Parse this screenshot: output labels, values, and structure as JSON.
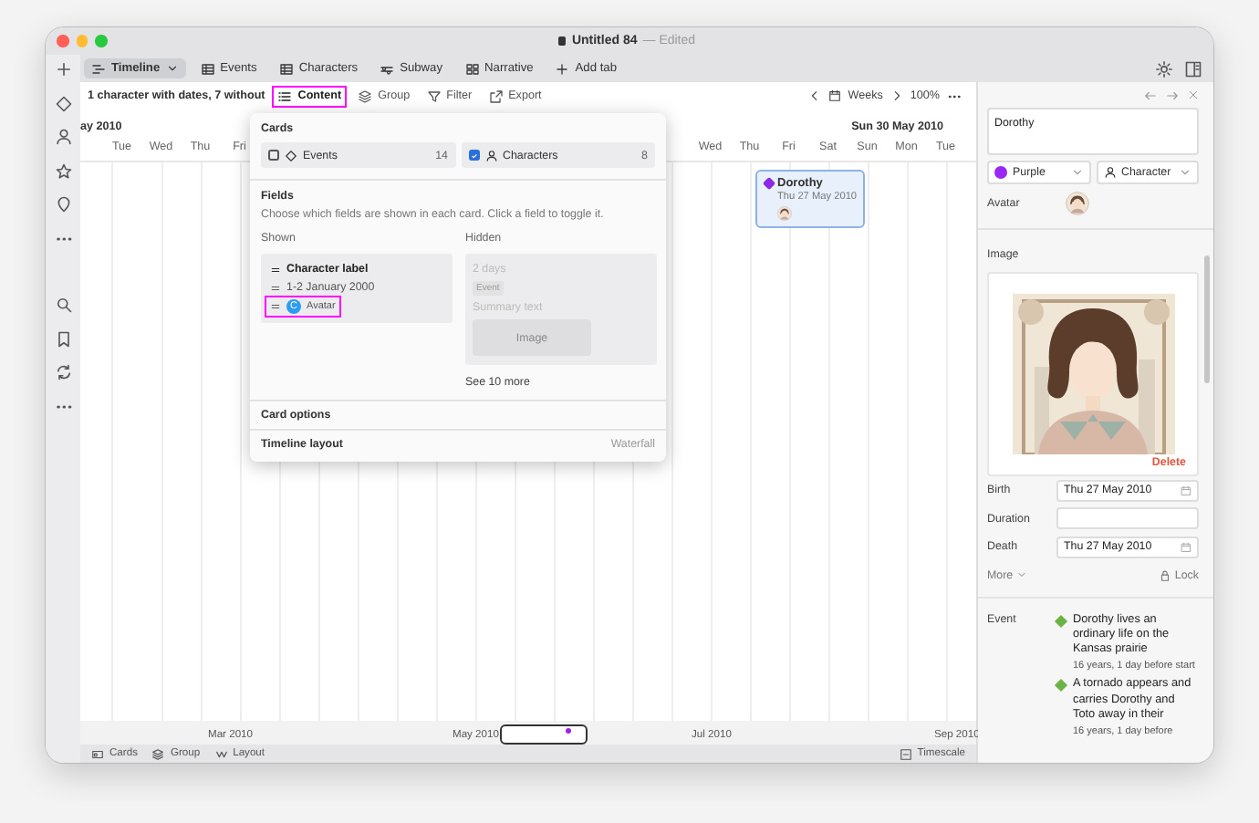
{
  "window": {
    "title": "Untitled 84",
    "status": "— Edited"
  },
  "sidebar": {
    "items": [
      {
        "kind": "add"
      },
      {
        "kind": "diamond"
      },
      {
        "kind": "person"
      },
      {
        "kind": "star"
      },
      {
        "kind": "pin"
      },
      {
        "kind": "dots"
      },
      {
        "kind": "search"
      },
      {
        "kind": "bookmark"
      },
      {
        "kind": "sync"
      },
      {
        "kind": "dots"
      }
    ]
  },
  "tabs": [
    {
      "label": "Timeline",
      "selected": true,
      "kind": "timeline"
    },
    {
      "label": "Events",
      "selected": false,
      "kind": "grid"
    },
    {
      "label": "Characters",
      "selected": false,
      "kind": "grid"
    },
    {
      "label": "Subway",
      "selected": false,
      "kind": "subway"
    },
    {
      "label": "Narrative",
      "selected": false,
      "kind": "narrative"
    },
    {
      "label": "Add tab",
      "selected": false,
      "kind": "plus"
    }
  ],
  "toolbar": {
    "summary": "1 character with dates, 7 without",
    "buttons": [
      {
        "label": "Content",
        "kind": "list",
        "highlighted": true
      },
      {
        "label": "Group",
        "kind": "stack",
        "highlighted": false
      },
      {
        "label": "Filter",
        "kind": "filter",
        "highlighted": false
      },
      {
        "label": "Export",
        "kind": "export",
        "highlighted": false
      }
    ],
    "scale": "Weeks",
    "zoom": "100%"
  },
  "timeline": {
    "month_labels": [
      "ay 2010",
      "Sun 30 May 2010"
    ],
    "days_before": [
      "Tue",
      "Wed",
      "Thu",
      "Fri"
    ],
    "days_after": [
      "Wed",
      "Thu",
      "Fri",
      "Sat",
      "Sun",
      "Mon",
      "Tue"
    ],
    "cards": [
      {
        "name": "Dorothy",
        "date": "Thu 27 May 2010",
        "color": "#8a2be2"
      }
    ]
  },
  "popover": {
    "cards_title": "Cards",
    "card_types": [
      {
        "label": "Events",
        "count": "14",
        "checked": false,
        "kind": "diamond"
      },
      {
        "label": "Characters",
        "count": "8",
        "checked": true,
        "kind": "person"
      }
    ],
    "fields_title": "Fields",
    "description": "Choose which fields are shown in each card. Click a field to toggle it.",
    "shown_title": "Shown",
    "shown": [
      {
        "label": "Character label",
        "kind": "title",
        "highlighted": false
      },
      {
        "label": "1-2 January 2000",
        "kind": "date",
        "highlighted": false
      },
      {
        "label": "Avatar",
        "kind": "avatar",
        "badge": "C",
        "highlighted": true
      }
    ],
    "hidden_title": "Hidden",
    "hidden": [
      {
        "label": "2 days",
        "kind": "text"
      },
      {
        "label": "Event",
        "kind": "tag"
      },
      {
        "label": "Summary text",
        "kind": "text"
      },
      {
        "label": "Image"
      }
    ],
    "more": "See 10 more",
    "sections": [
      {
        "label": "Card options"
      },
      {
        "label": "Timeline layout",
        "value": "Waterfall"
      }
    ]
  },
  "inspector": {
    "name": "Dorothy",
    "color": {
      "label": "Purple",
      "color": "#9b27f5"
    },
    "type": "Character",
    "avatar_label": "Avatar",
    "image_label": "Image",
    "delete": "Delete",
    "dates": [
      {
        "label": "Birth",
        "value": "Thu 27 May 2010",
        "kind": "date"
      },
      {
        "label": "Duration",
        "kind": "text"
      },
      {
        "label": "Death",
        "value": "Thu 27 May 2010",
        "kind": "date"
      }
    ],
    "more": "More",
    "lock": "Lock",
    "event_label": "Event",
    "events": [
      {
        "title": "Dorothy lives an ordinary life on the Kansas prairie",
        "detail": "16 years, 1 day before start",
        "color": "#6ab344"
      },
      {
        "title": "A tornado appears and carries Dorothy and Toto away in their",
        "detail": "16 years, 1 day before",
        "color": "#6ab344"
      }
    ]
  },
  "overview": {
    "months": [
      "Mar 2010",
      "May 2010",
      "Jul 2010",
      "Sep 2010"
    ]
  },
  "status_bar": {
    "left": [
      {
        "label": "Cards",
        "kind": "cards"
      },
      {
        "label": "Group",
        "kind": "stack"
      },
      {
        "label": "Layout",
        "kind": "layout"
      }
    ],
    "right": [
      {
        "label": "Timescale",
        "kind": "timescale"
      }
    ]
  }
}
